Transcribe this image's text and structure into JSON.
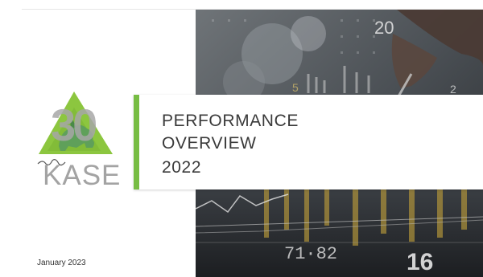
{
  "logo": {
    "number": "30",
    "wordmark": "KASE",
    "triangle_color": "#8cc63f",
    "figure_color": "#5fa05a"
  },
  "cover": {
    "title_lines": [
      "PERFORMANCE",
      "OVERVIEW",
      "2022"
    ],
    "accent_color": "#77bd43",
    "date": "January 2023"
  },
  "background_photo": {
    "overlay_numbers": [
      "20",
      "5",
      "2",
      "71·82",
      "16"
    ]
  }
}
